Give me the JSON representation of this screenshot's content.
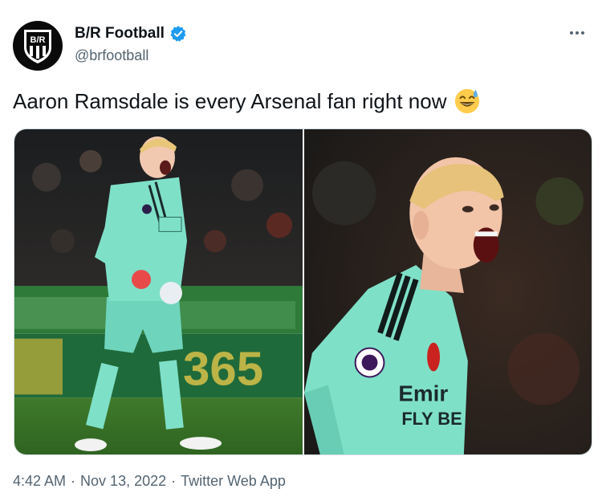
{
  "author": {
    "display_name": "B/R Football",
    "handle": "@brfootball",
    "avatar_icon": "br-shield-logo-icon",
    "verified_icon": "verified-badge-icon",
    "verified_color": "#1d9bf0"
  },
  "menu": {
    "icon": "more-options-icon"
  },
  "tweet": {
    "text": "Aaron Ramsdale is every Arsenal fan right now",
    "emoji_icon": "grinning-sweat-emoji-icon"
  },
  "media": {
    "photos": [
      {
        "icon": "goalkeeper-celebrating-full-body-photo"
      },
      {
        "icon": "goalkeeper-shouting-closeup-photo"
      }
    ]
  },
  "meta": {
    "time": "4:42 AM",
    "separator": "·",
    "date": "Nov 13, 2022",
    "source": "Twitter Web App"
  },
  "colors": {
    "text_primary": "#0f1419",
    "text_secondary": "#536471",
    "kit_green": "#7fe0c8"
  }
}
